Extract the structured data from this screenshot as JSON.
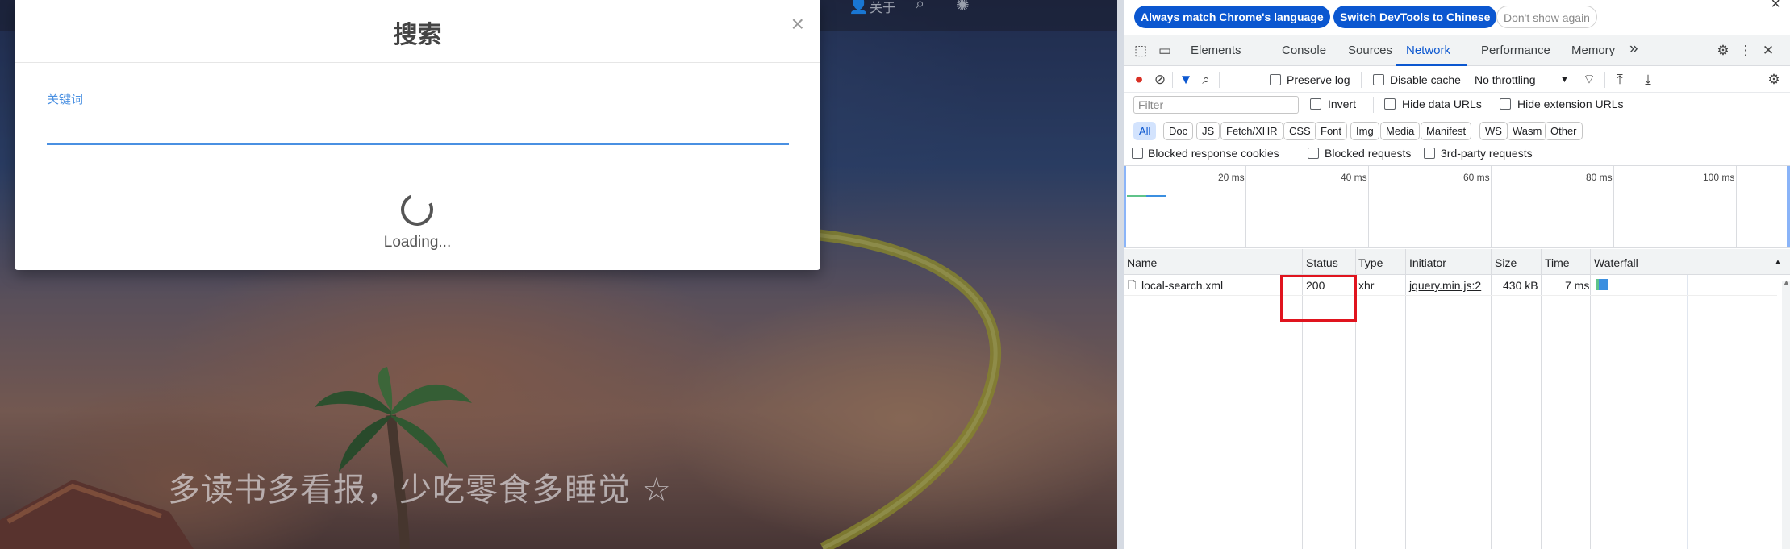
{
  "site": {
    "motto": "多读书多看报，少吃零食多睡觉 ☆",
    "topbar_about": "关于"
  },
  "modal": {
    "title": "搜索",
    "close": "×",
    "keyword_label": "关键词",
    "keyword_value": "",
    "loading_text": "Loading..."
  },
  "devtools": {
    "notice": {
      "match_language": "Always match Chrome's language",
      "switch_chinese": "Switch DevTools to Chinese",
      "dont_show": "Don't show again",
      "close": "×"
    },
    "tabs": [
      "Elements",
      "Console",
      "Sources",
      "Network",
      "Performance",
      "Memory"
    ],
    "active_tab": "Network",
    "more_tabs": "»",
    "toolbar": {
      "preserve_log": "Preserve log",
      "disable_cache": "Disable cache",
      "throttling": "No throttling"
    },
    "filter": {
      "placeholder": "Filter",
      "invert": "Invert",
      "hide_data_urls": "Hide data URLs",
      "hide_extension_urls": "Hide extension URLs"
    },
    "types": [
      "All",
      "Doc",
      "JS",
      "Fetch/XHR",
      "CSS",
      "Font",
      "Img",
      "Media",
      "Manifest",
      "WS",
      "Wasm",
      "Other"
    ],
    "active_type": "All",
    "blocking": {
      "blocked_cookies": "Blocked response cookies",
      "blocked_requests": "Blocked requests",
      "third_party": "3rd-party requests"
    },
    "overview_ticks": [
      "20 ms",
      "40 ms",
      "60 ms",
      "80 ms",
      "100 ms"
    ],
    "columns": [
      "Name",
      "Status",
      "Type",
      "Initiator",
      "Size",
      "Time",
      "Waterfall"
    ],
    "requests": [
      {
        "name": "local-search.xml",
        "status": "200",
        "type": "xhr",
        "initiator": "jquery.min.js:2",
        "size": "430 kB",
        "time": "7 ms"
      }
    ],
    "colors": {
      "accent": "#0b57d0",
      "highlight_box": "#e0141e",
      "waterfall_wait": "#5fc38a",
      "waterfall_download": "#3b8fe0"
    }
  }
}
